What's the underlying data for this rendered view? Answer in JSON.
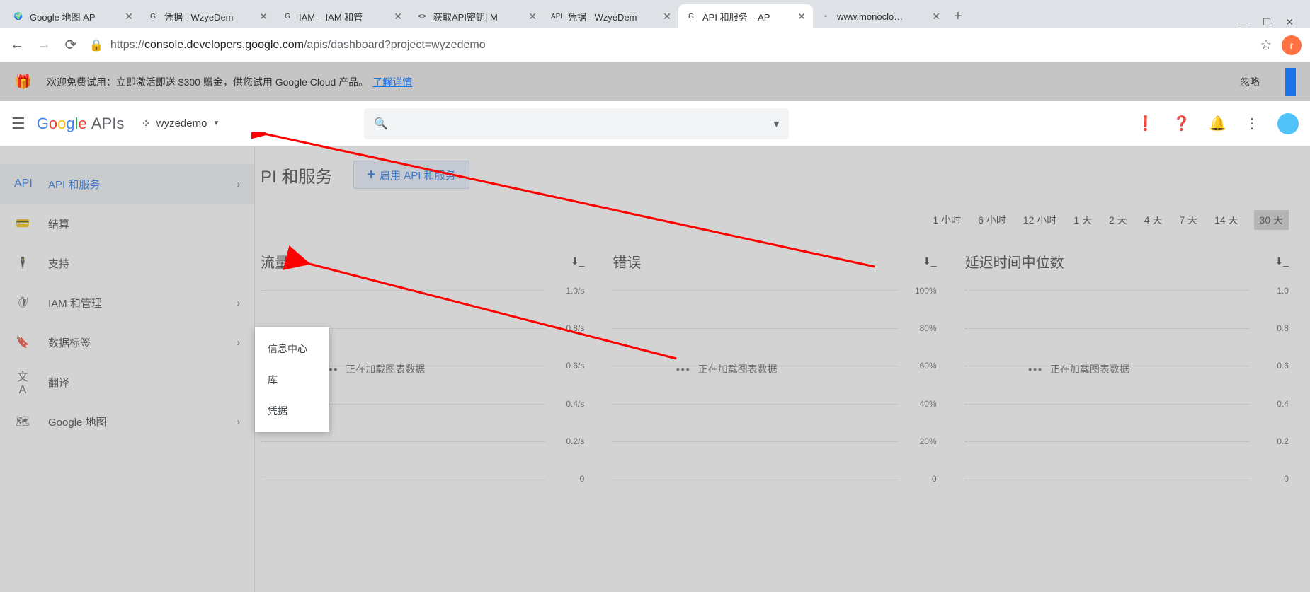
{
  "browser": {
    "tabs": [
      {
        "title": "Google 地图 AP",
        "favicon": "🌍"
      },
      {
        "title": "凭据 - WzyeDem",
        "favicon": "G"
      },
      {
        "title": "IAM – IAM 和管",
        "favicon": "G"
      },
      {
        "title": "获取API密钥| M",
        "favicon": "<>"
      },
      {
        "title": "凭据 - WzyeDem",
        "favicon": "API"
      },
      {
        "title": "API 和服务 – AP",
        "favicon": "G",
        "active": true
      },
      {
        "title": "www.monoclo…",
        "favicon": "▫"
      }
    ],
    "url_prefix": "https://",
    "url_domain": "console.developers.google.com",
    "url_path": "/apis/dashboard?project=wyzedemo"
  },
  "trial": {
    "text_prefix": "欢迎免费试用：立即激活即送 $300 赠金，供您试用 Google Cloud 产品。",
    "link": "了解详情",
    "dismiss": "忽略"
  },
  "header": {
    "project": "wyzedemo",
    "search_placeholder": ""
  },
  "sidebar": {
    "items": [
      {
        "icon": "API",
        "label": "API 和服务",
        "chevron": true,
        "active": true
      },
      {
        "icon": "💳",
        "label": "结算"
      },
      {
        "icon": "🕴",
        "label": "支持"
      },
      {
        "icon": "🛡",
        "label": "IAM 和管理",
        "chevron": true
      },
      {
        "icon": "🔖",
        "label": "数据标签",
        "chevron": true
      },
      {
        "icon": "文A",
        "label": "翻译"
      },
      {
        "icon": "🗺",
        "label": "Google 地图",
        "chevron": true
      }
    ]
  },
  "submenu": {
    "items": [
      "信息中心",
      "库",
      "凭据"
    ]
  },
  "main": {
    "title": "PI 和服务",
    "enable_btn": "启用 API 和服务",
    "time_ranges": [
      "1 小时",
      "6 小时",
      "12 小时",
      "1 天",
      "2 天",
      "4 天",
      "7 天",
      "14 天",
      "30 天"
    ],
    "active_range": "30 天",
    "loading_text": "正在加载图表数据"
  },
  "chart_data": [
    {
      "type": "line",
      "title": "流量",
      "ylabel": "",
      "y_ticks": [
        "1.0/s",
        "0.8/s",
        "0.6/s",
        "0.4/s",
        "0.2/s",
        "0"
      ],
      "ylim": [
        0,
        1.0
      ],
      "series": [],
      "loading": true
    },
    {
      "type": "line",
      "title": "错误",
      "ylabel": "",
      "y_ticks": [
        "100%",
        "80%",
        "60%",
        "40%",
        "20%",
        "0"
      ],
      "ylim": [
        0,
        100
      ],
      "series": [],
      "loading": true
    },
    {
      "type": "line",
      "title": "延迟时间中位数",
      "ylabel": "",
      "y_ticks": [
        "1.0",
        "0.8",
        "0.6",
        "0.4",
        "0.2",
        "0"
      ],
      "ylim": [
        0,
        1.0
      ],
      "series": [],
      "loading": true
    }
  ]
}
